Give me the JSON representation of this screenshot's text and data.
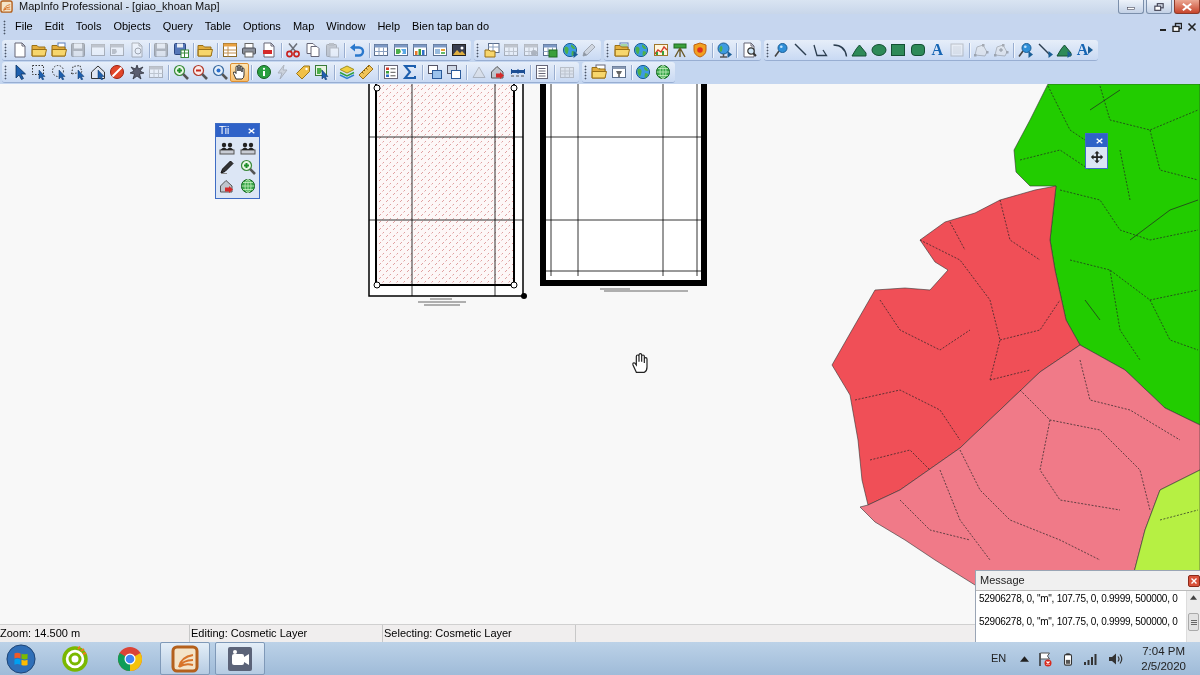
{
  "window": {
    "title": "MapInfo Professional - [giao_khoan Map]"
  },
  "menu": [
    "File",
    "Edit",
    "Tools",
    "Objects",
    "Query",
    "Table",
    "Options",
    "Map",
    "Window",
    "Help",
    "Bien tap ban do"
  ],
  "toolbar_rows": [
    {
      "groups": [
        {
          "buttons": [
            {
              "disabled": false
            },
            {
              "disabled": false
            },
            {
              "disabled": false
            },
            {
              "disabled": true
            },
            {
              "disabled": true
            },
            {
              "disabled": true
            },
            {
              "disabled": true
            },
            {
              "disabled": true
            },
            {
              "disabled": false
            },
            {
              "disabled": false
            },
            {
              "disabled": false
            },
            {
              "disabled": false
            },
            {
              "disabled": false
            },
            {
              "disabled": false
            },
            {
              "disabled": false
            },
            {
              "disabled": true
            },
            {
              "disabled": false
            },
            {
              "disabled": false
            },
            {
              "disabled": false
            },
            {
              "disabled": false
            },
            {
              "disabled": false
            },
            {
              "disabled": false
            }
          ]
        },
        {
          "buttons": [
            {
              "disabled": false
            },
            {
              "disabled": true
            },
            {
              "disabled": true
            },
            {
              "disabled": false
            },
            {
              "disabled": false
            },
            {
              "disabled": true
            }
          ]
        },
        {
          "buttons": [
            {
              "disabled": false
            },
            {
              "disabled": false
            },
            {
              "disabled": false
            },
            {
              "disabled": false
            },
            {
              "disabled": false
            },
            {
              "disabled": false
            },
            {
              "disabled": false
            }
          ]
        },
        {
          "buttons": [
            {
              "disabled": false
            },
            {
              "disabled": false
            },
            {
              "disabled": false
            },
            {
              "disabled": false
            },
            {
              "disabled": false
            },
            {
              "disabled": false
            },
            {
              "disabled": false
            },
            {
              "disabled": false
            },
            {
              "disabled": false,
              "label": "A"
            },
            {
              "disabled": true
            },
            {
              "disabled": true
            },
            {
              "disabled": true
            },
            {
              "disabled": false
            },
            {
              "disabled": false
            },
            {
              "disabled": false
            },
            {
              "disabled": false,
              "label": "A"
            }
          ]
        }
      ]
    },
    {
      "groups": [
        {
          "buttons": [
            {
              "disabled": false,
              "selected": false
            },
            {
              "disabled": false,
              "selected": false
            },
            {
              "disabled": false,
              "selected": false
            },
            {
              "disabled": false,
              "selected": false
            },
            {
              "disabled": false,
              "selected": false
            },
            {
              "disabled": false,
              "selected": false
            },
            {
              "disabled": false,
              "selected": false
            },
            {
              "disabled": true,
              "selected": false
            },
            {
              "disabled": false,
              "selected": false
            },
            {
              "disabled": false,
              "selected": false
            },
            {
              "disabled": false,
              "selected": false
            },
            {
              "disabled": false,
              "selected": true
            },
            {
              "disabled": false,
              "selected": false
            },
            {
              "disabled": true,
              "selected": false
            },
            {
              "disabled": false,
              "selected": false
            },
            {
              "disabled": false,
              "selected": false
            },
            {
              "disabled": false,
              "selected": false
            },
            {
              "disabled": false,
              "selected": false
            },
            {
              "disabled": false,
              "selected": false
            },
            {
              "disabled": false,
              "selected": false
            },
            {
              "disabled": false,
              "selected": false
            },
            {
              "disabled": false,
              "selected": false
            },
            {
              "disabled": true,
              "selected": false
            },
            {
              "disabled": false,
              "selected": false
            },
            {
              "disabled": false,
              "selected": false
            },
            {
              "disabled": false,
              "selected": false
            },
            {
              "disabled": true,
              "selected": false
            }
          ]
        },
        {
          "buttons": [
            {
              "disabled": false
            },
            {
              "disabled": false
            },
            {
              "disabled": false
            },
            {
              "disabled": false
            }
          ]
        }
      ]
    }
  ],
  "map": {
    "regions": [
      {
        "color": "#22cc00"
      },
      {
        "color": "#f04f57"
      },
      {
        "color": "#f07a88"
      },
      {
        "color": "#b6f043"
      }
    ]
  },
  "tool_palette": {
    "title": "Tii"
  },
  "message_window": {
    "title": "Message",
    "lines": [
      "52906278, 0, \"m\", 107.75, 0, 0.9999, 500000, 0",
      "52906278, 0, \"m\", 107.75, 0, 0.9999, 500000, 0"
    ]
  },
  "status_bar": [
    "Zoom: 14.500 m",
    "Editing: Cosmetic Layer",
    "Selecting: Cosmetic Layer"
  ],
  "taskbar": {
    "apps": [
      {
        "active": false
      },
      {
        "active": false
      },
      {
        "active": true
      },
      {
        "active": true
      }
    ],
    "language": "EN",
    "time": "7:04 PM",
    "date": "2/5/2020"
  }
}
